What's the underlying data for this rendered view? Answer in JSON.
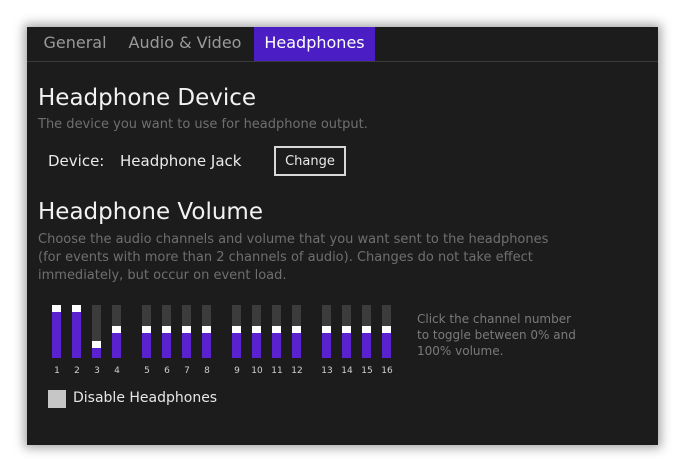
{
  "tabs": [
    {
      "label": "General",
      "active": false
    },
    {
      "label": "Audio & Video",
      "active": false
    },
    {
      "label": "Headphones",
      "active": true
    }
  ],
  "device_section": {
    "title": "Headphone Device",
    "description": "The device you want to use for headphone output.",
    "device_label": "Device:",
    "device_value": "Headphone Jack",
    "change_label": "Change"
  },
  "volume_section": {
    "title": "Headphone Volume",
    "description_lines": [
      "Choose the audio channels and volume that you want sent to the headphones",
      "(for events with more than 2 channels of audio). Changes do not take effect",
      "immediately, but occur on event load."
    ],
    "hint_lines": [
      "Click the channel number",
      "to toggle between 0% and",
      "100% volume."
    ],
    "channels": [
      {
        "label": "1",
        "level": 1.0
      },
      {
        "label": "2",
        "level": 1.0
      },
      {
        "label": "3",
        "level": 0.3
      },
      {
        "label": "4",
        "level": 0.58
      },
      {
        "label": "5",
        "level": 0.58
      },
      {
        "label": "6",
        "level": 0.58
      },
      {
        "label": "7",
        "level": 0.58
      },
      {
        "label": "8",
        "level": 0.58
      },
      {
        "label": "9",
        "level": 0.58
      },
      {
        "label": "10",
        "level": 0.58
      },
      {
        "label": "11",
        "level": 0.58
      },
      {
        "label": "12",
        "level": 0.58
      },
      {
        "label": "13",
        "level": 0.58
      },
      {
        "label": "14",
        "level": 0.58
      },
      {
        "label": "15",
        "level": 0.58
      },
      {
        "label": "16",
        "level": 0.58
      }
    ]
  },
  "disable_headphones": {
    "label": "Disable Headphones",
    "checked": false
  },
  "colors": {
    "accent": "#4a1ec4",
    "fill": "#5a22cf",
    "background": "#1c1c1c"
  }
}
